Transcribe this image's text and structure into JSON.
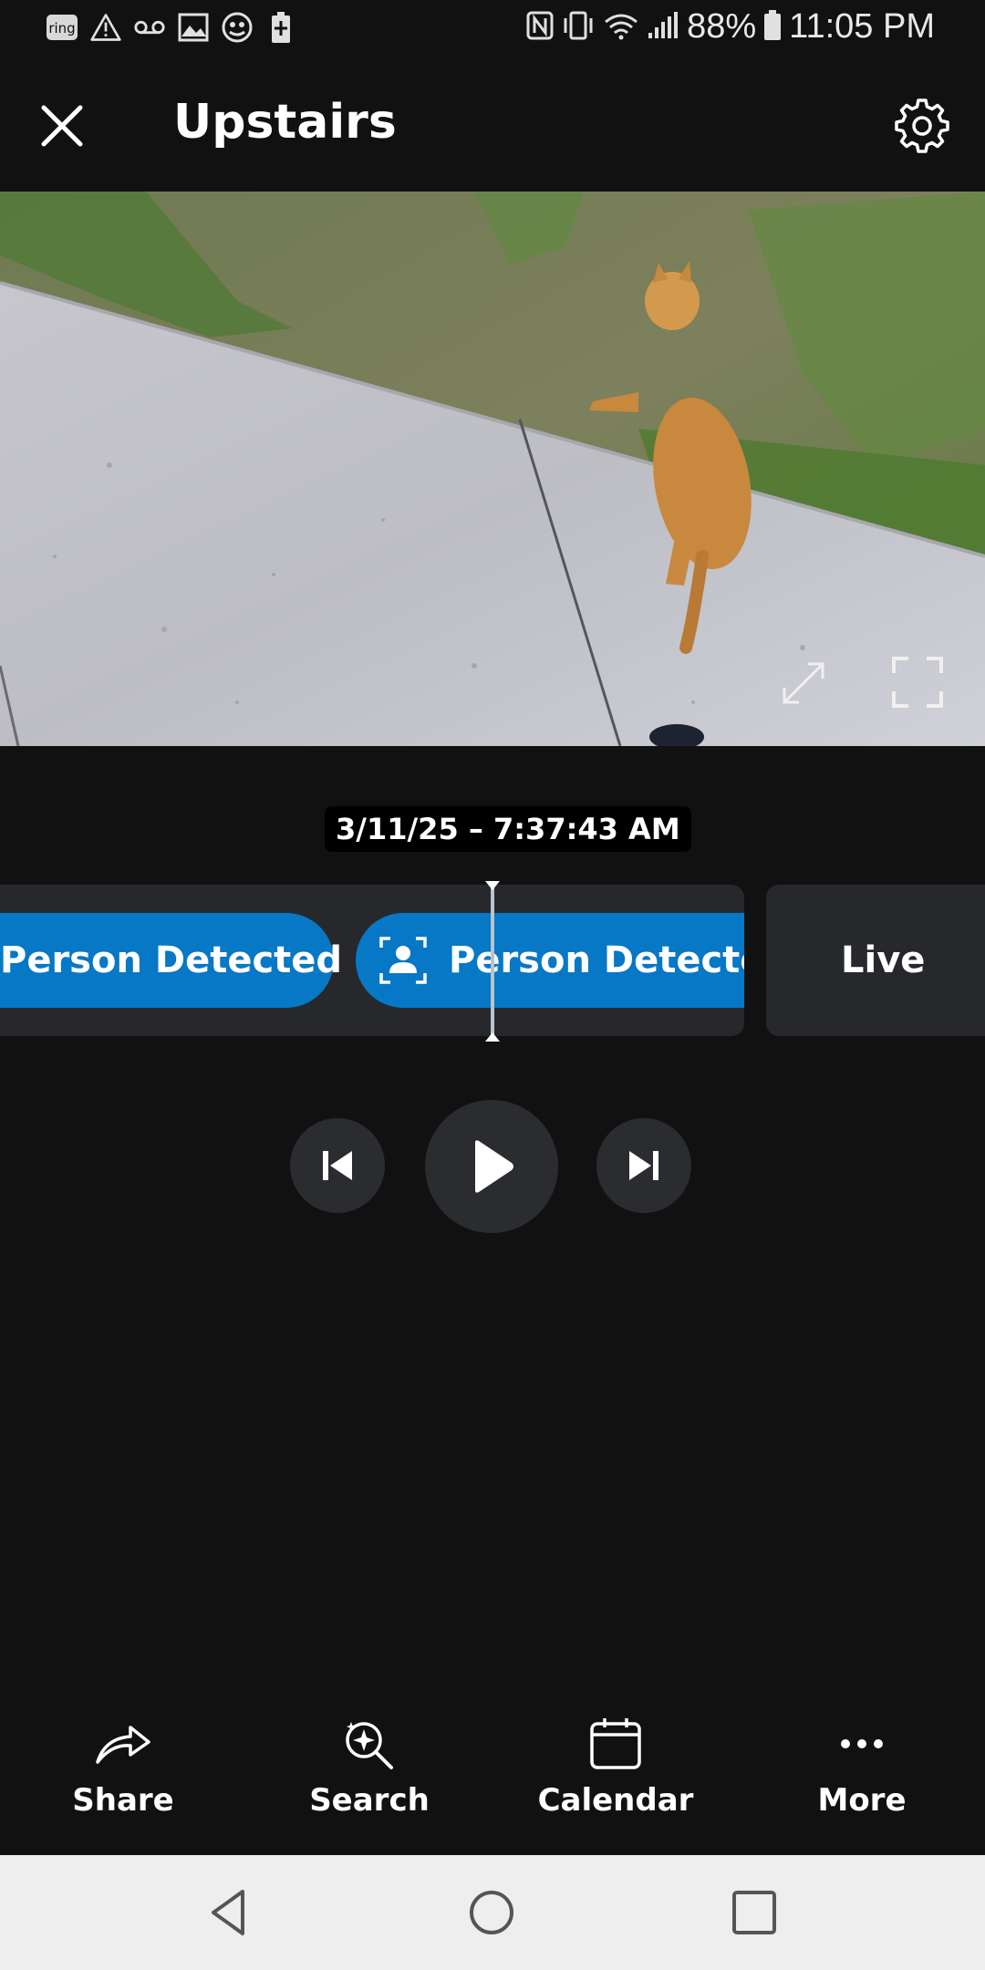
{
  "status_bar": {
    "battery_percent": "88%",
    "time": "11:05 PM",
    "left_icons": [
      "ring-icon",
      "warning-icon",
      "voicemail-icon",
      "image-icon",
      "vpn-icon",
      "battery-charging-icon"
    ],
    "right_icons": [
      "nfc-icon",
      "vibrate-icon",
      "wifi-icon",
      "signal-icon",
      "battery-icon"
    ]
  },
  "header": {
    "title": "Upstairs"
  },
  "video": {
    "description_icons": [
      "expand-icon",
      "fullscreen-icon"
    ]
  },
  "timeline": {
    "timestamp": "3/11/25 – 7:37:43 AM",
    "events": [
      {
        "label": "Person Detected"
      },
      {
        "label": "Person Detected"
      }
    ],
    "live_label": "Live",
    "accent_color": "#0678c6"
  },
  "playback": {
    "controls": [
      "previous-icon",
      "play-icon",
      "next-icon"
    ]
  },
  "actions": {
    "share": "Share",
    "search": "Search",
    "calendar": "Calendar",
    "more": "More"
  }
}
